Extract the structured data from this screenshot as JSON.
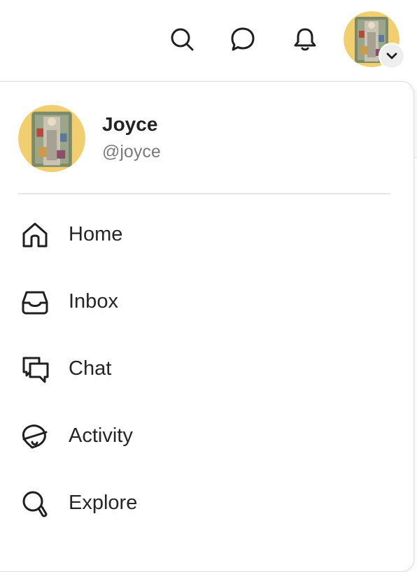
{
  "topbar": {
    "icons": [
      "search-icon",
      "chat-bubble-icon",
      "bell-icon"
    ],
    "avatar_menu_icon": "chevron-down-icon"
  },
  "profile": {
    "name": "Joyce",
    "handle": "@joyce"
  },
  "menu": {
    "items": [
      {
        "label": "Home",
        "icon": "home-icon"
      },
      {
        "label": "Inbox",
        "icon": "inbox-icon"
      },
      {
        "label": "Chat",
        "icon": "chat-icon"
      },
      {
        "label": "Activity",
        "icon": "activity-icon"
      },
      {
        "label": "Explore",
        "icon": "explore-icon"
      }
    ]
  },
  "colors": {
    "text": "#222222",
    "muted": "#7a7a7a",
    "divider": "#e6e6e6",
    "avatar_ring": "#f2cf6e",
    "badge_bg": "#eeeeee"
  }
}
